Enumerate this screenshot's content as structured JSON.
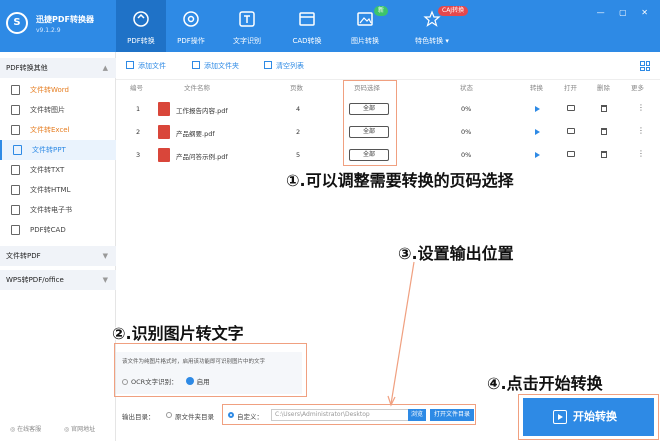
{
  "app": {
    "name": "迅捷PDF转换器",
    "version": "v9.1.2.9",
    "logo_glyph": "S"
  },
  "nav": [
    {
      "label": "PDF转换",
      "active": true
    },
    {
      "label": "PDF操作"
    },
    {
      "label": "文字识别"
    },
    {
      "label": "CAD转换"
    },
    {
      "label": "图片转换",
      "badge": "新"
    },
    {
      "label": "特色转换 ▾",
      "badge": "CAJ转换"
    }
  ],
  "window_controls": "— ▢ ✕",
  "sidebar": {
    "groups": [
      {
        "label": "PDF转换其他"
      },
      {
        "label": "文件转PDF"
      },
      {
        "label": "WPS转PDF/office"
      }
    ],
    "items": [
      {
        "label": "文件转Word",
        "style": "orange"
      },
      {
        "label": "文件转图片"
      },
      {
        "label": "文件转Excel",
        "style": "orange"
      },
      {
        "label": "文件转PPT",
        "style": "active"
      },
      {
        "label": "文件转TXT"
      },
      {
        "label": "文件转HTML"
      },
      {
        "label": "文件转电子书"
      },
      {
        "label": "PDF转CAD"
      }
    ],
    "footer": {
      "left": "在线客服",
      "right": "官网地址"
    }
  },
  "toolbar": {
    "add_file": "添加文件",
    "add_folder": "添加文件夹",
    "clear_list": "清空列表"
  },
  "table": {
    "headers": {
      "num": "编号",
      "name": "文件名称",
      "pages": "页数",
      "range": "页码选择",
      "status": "状态",
      "convert": "转换",
      "open": "打开",
      "delete": "删除",
      "more": "更多"
    },
    "rows": [
      {
        "num": "1",
        "name": "工作报告内容.pdf",
        "pages": "4",
        "range": "全部",
        "status": "0%"
      },
      {
        "num": "2",
        "name": "产品纲要.pdf",
        "pages": "2",
        "range": "全部",
        "status": "0%"
      },
      {
        "num": "3",
        "name": "产品问答示例.pdf",
        "pages": "5",
        "range": "全部",
        "status": "0%"
      }
    ]
  },
  "ocr": {
    "description": "该文件为纯图片格式时，启用该功能即可识别图片中的文字",
    "label": "OCR文字识别：",
    "enabled": "启用"
  },
  "output": {
    "label": "输出目录：",
    "source_option": "原文件夹目录",
    "custom_option": "自定义：",
    "path": "C:\\Users\\Administrator\\Desktop",
    "browse": "浏览",
    "open_folder": "打开文件目录"
  },
  "start_button": "开始转换",
  "annotations": {
    "a1": "①.可以调整需要转换的页码选择",
    "a2": "②.识别图片转文字",
    "a3": "③.设置输出位置",
    "a4": "④.点击开始转换"
  },
  "colors": {
    "primary": "#2e8ae5",
    "callout": "#f0a080",
    "new_badge": "#3cc46b",
    "caj_badge": "#e5484d",
    "pdf_icon": "#d9463a"
  }
}
